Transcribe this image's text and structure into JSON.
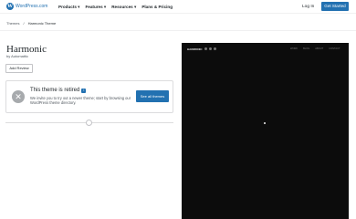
{
  "header": {
    "brand": "WordPress.com",
    "logo_letter": "W",
    "nav": [
      "Products ▾",
      "Features ▾",
      "Resources ▾",
      "Plans & Pricing"
    ],
    "login": "Log In",
    "cta": "Get Started"
  },
  "breadcrumb": {
    "root": "Themes",
    "sep": "/",
    "current": "Harmonic Theme"
  },
  "theme": {
    "title": "Harmonic",
    "author": "by Automattic",
    "add_review": "Add Review"
  },
  "notice": {
    "icon": "✕",
    "title": "This theme is retired",
    "info": "i",
    "message": "We invite you to try out a newer theme; start by browsing our WordPress theme directory.",
    "button": "See all themes"
  },
  "preview": {
    "brand": "HARMONIC",
    "nav": [
      "WORK",
      "BLOG",
      "ABOUT",
      "CONTACT"
    ]
  },
  "colors": {
    "accent": "#2271b1",
    "preview_bg": "#0c0c0c"
  }
}
